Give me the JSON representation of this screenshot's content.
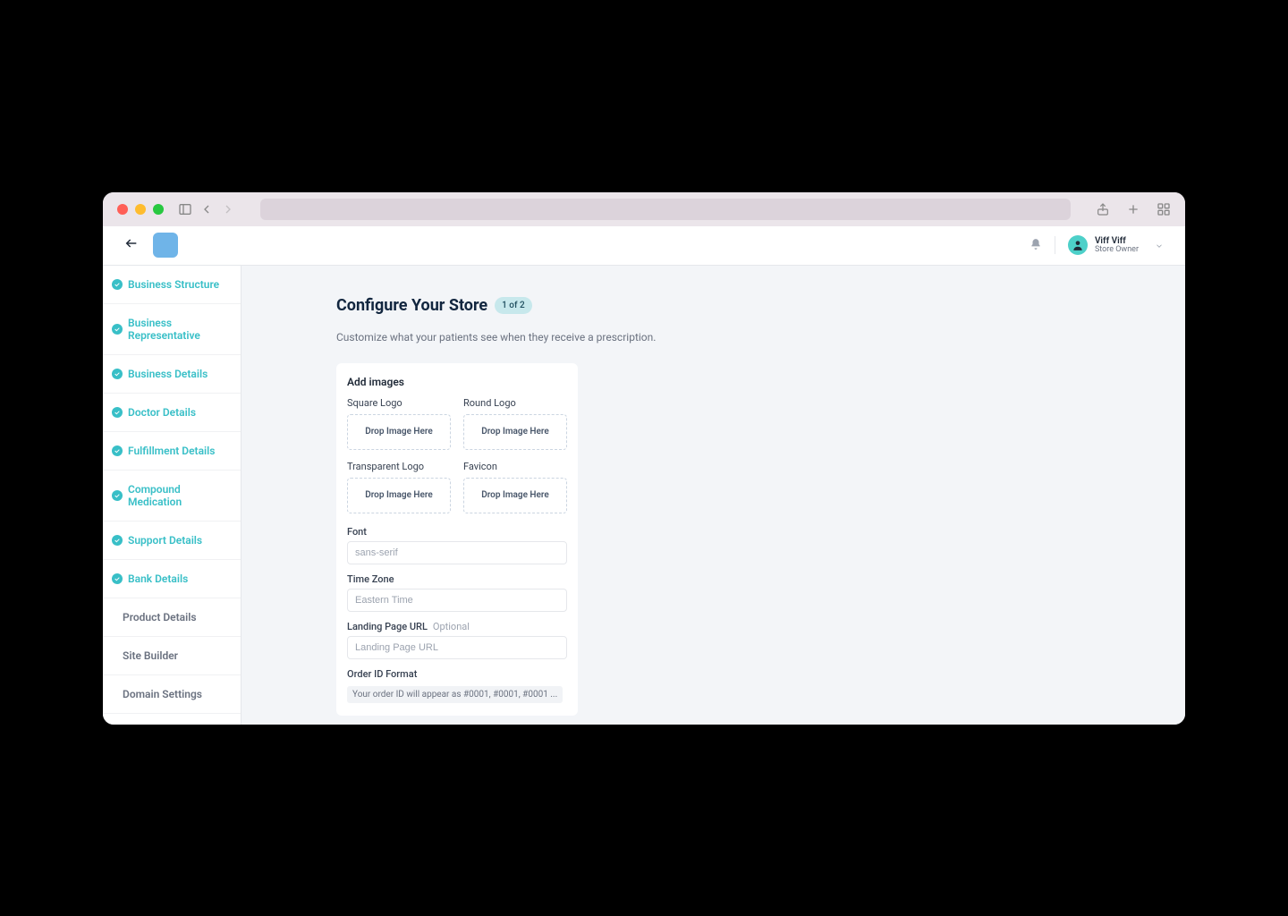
{
  "header": {
    "user_name": "Viff Viff",
    "user_role": "Store Owner"
  },
  "sidebar": {
    "items": [
      {
        "label": "Business Structure",
        "completed": true
      },
      {
        "label": "Business Representative",
        "completed": true
      },
      {
        "label": "Business Details",
        "completed": true
      },
      {
        "label": "Doctor Details",
        "completed": true
      },
      {
        "label": "Fulfillment Details",
        "completed": true
      },
      {
        "label": "Compound Medication",
        "completed": true
      },
      {
        "label": "Support Details",
        "completed": true
      },
      {
        "label": "Bank Details",
        "completed": true
      },
      {
        "label": "Product Details",
        "completed": false
      },
      {
        "label": "Site Builder",
        "completed": false
      },
      {
        "label": "Domain Settings",
        "completed": false
      }
    ]
  },
  "main": {
    "title": "Configure Your Store",
    "step": "1 of 2",
    "subtitle": "Customize what your patients see when they receive a prescription.",
    "add_images_title": "Add images",
    "uploads": [
      {
        "label": "Square Logo",
        "drop_text": "Drop Image Here"
      },
      {
        "label": "Round Logo",
        "drop_text": "Drop Image Here"
      },
      {
        "label": "Transparent Logo",
        "drop_text": "Drop Image Here"
      },
      {
        "label": "Favicon",
        "drop_text": "Drop Image Here"
      }
    ],
    "font": {
      "label": "Font",
      "placeholder": "sans-serif"
    },
    "timezone": {
      "label": "Time Zone",
      "placeholder": "Eastern Time"
    },
    "landing": {
      "label": "Landing Page URL",
      "optional": "Optional",
      "placeholder": "Landing Page URL"
    },
    "order_id": {
      "label": "Order ID Format",
      "hint": "Your order ID will appear as #0001, #0001, #0001 ..."
    }
  }
}
